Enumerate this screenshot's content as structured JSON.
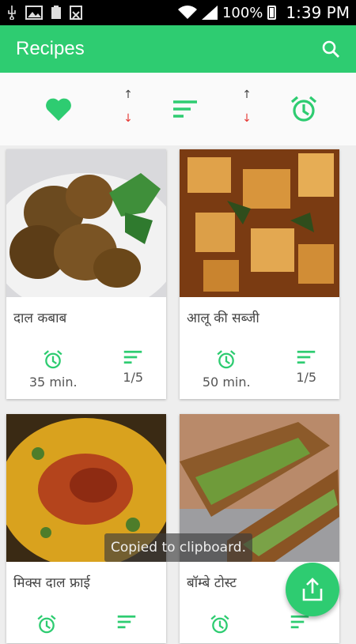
{
  "status_bar": {
    "battery": "100%",
    "time": "1:39 PM"
  },
  "app_bar": {
    "title": "Recipes"
  },
  "filters": {
    "up_arrow": "↑",
    "down_arrow": "↓"
  },
  "cards": [
    {
      "title": "दाल कबाब",
      "time": "35 min.",
      "difficulty": "1/5"
    },
    {
      "title": "आलू की सब्जी",
      "time": "50 min.",
      "difficulty": "1/5"
    },
    {
      "title": "मिक्स दाल फ्राई",
      "time": "",
      "difficulty": ""
    },
    {
      "title": "बॉम्बे टोस्ट",
      "time": "",
      "difficulty": ""
    }
  ],
  "toast": {
    "text": "Copied to clipboard."
  },
  "colors": {
    "accent": "#2ecc71",
    "arrow_down": "#e53935"
  }
}
